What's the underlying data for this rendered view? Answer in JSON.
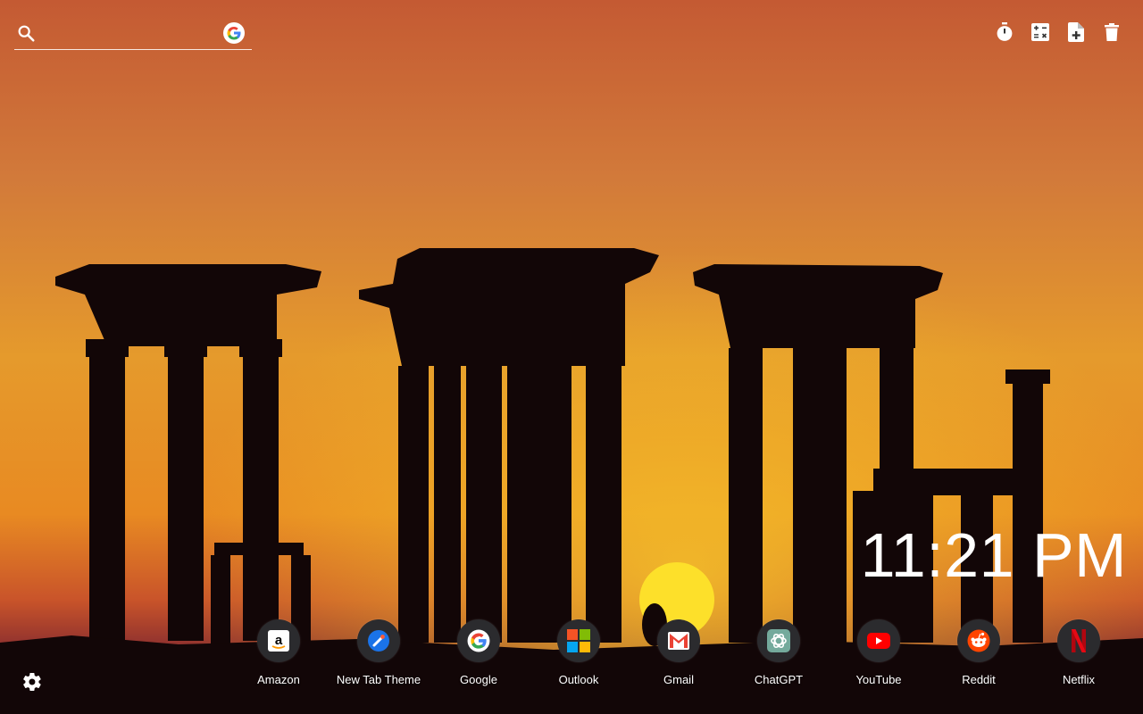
{
  "search": {
    "placeholder": ""
  },
  "header_tools": [
    {
      "icon": "stopwatch-icon"
    },
    {
      "icon": "calculator-icon"
    },
    {
      "icon": "add-note-icon"
    },
    {
      "icon": "trash-icon"
    }
  ],
  "clock": {
    "time": "11:21 PM"
  },
  "shortcuts": [
    {
      "label": "Amazon",
      "icon": "amazon-icon"
    },
    {
      "label": "New Tab Theme",
      "icon": "new-tab-theme-icon"
    },
    {
      "label": "Google",
      "icon": "google-icon"
    },
    {
      "label": "Outlook",
      "icon": "outlook-icon"
    },
    {
      "label": "Gmail",
      "icon": "gmail-icon"
    },
    {
      "label": "ChatGPT",
      "icon": "chatgpt-icon"
    },
    {
      "label": "YouTube",
      "icon": "youtube-icon"
    },
    {
      "label": "Reddit",
      "icon": "reddit-icon"
    },
    {
      "label": "Netflix",
      "icon": "netflix-icon"
    }
  ],
  "colors": {
    "sky_top": "#c85a32",
    "sky_mid": "#e0892e",
    "sky_glow": "#f0b020",
    "horizon": "#c84a2a",
    "silhouette": "#120607",
    "sun": "#fde02a",
    "dock_circle": "#2b2b2e"
  }
}
